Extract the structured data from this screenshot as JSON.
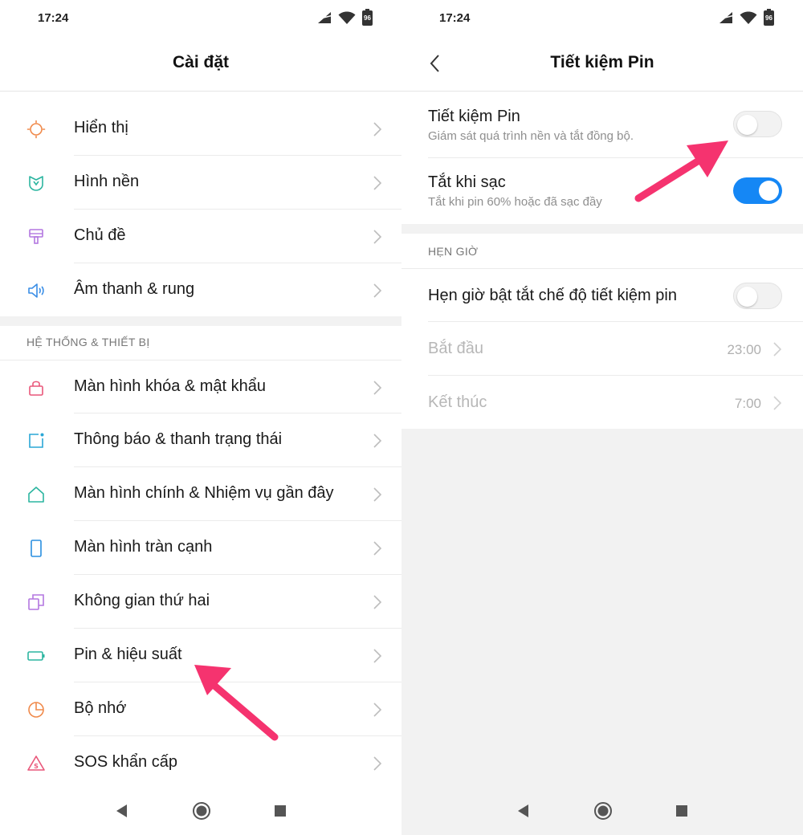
{
  "left": {
    "status": {
      "time": "17:24",
      "battery": "96"
    },
    "title": "Cài đặt",
    "items_top": [
      {
        "label": "Hiển thị",
        "icon": "display-icon"
      },
      {
        "label": "Hình nền",
        "icon": "wallpaper-icon"
      },
      {
        "label": "Chủ đề",
        "icon": "theme-brush-icon"
      },
      {
        "label": "Âm thanh & rung",
        "icon": "speaker-icon"
      }
    ],
    "section_label": "HỆ THỐNG & THIẾT BỊ",
    "items_system": [
      {
        "label": "Màn hình khóa & mật khẩu",
        "icon": "lock-icon"
      },
      {
        "label": "Thông báo & thanh trạng thái",
        "icon": "notification-icon"
      },
      {
        "label": "Màn hình chính & Nhiệm vụ gần đây",
        "icon": "home-icon"
      },
      {
        "label": "Màn hình tràn cạnh",
        "icon": "phone-icon"
      },
      {
        "label": "Không gian thứ hai",
        "icon": "second-space-icon"
      },
      {
        "label": "Pin & hiệu suất",
        "icon": "battery-icon"
      },
      {
        "label": "Bộ nhớ",
        "icon": "storage-pie-icon"
      },
      {
        "label": "SOS khẩn cấp",
        "icon": "sos-icon"
      }
    ]
  },
  "right": {
    "status": {
      "time": "17:24",
      "battery": "96"
    },
    "title": "Tiết kiệm Pin",
    "battery_saver": {
      "title": "Tiết kiệm Pin",
      "subtitle": "Giám sát quá trình nền và tắt đồng bộ.",
      "enabled": false
    },
    "off_when_charging": {
      "title": "Tắt khi sạc",
      "subtitle": "Tắt khi pin 60% hoặc đã sạc đầy",
      "enabled": true
    },
    "section_label": "HẸN GIỜ",
    "schedule": {
      "title": "Hẹn giờ bật tắt chế độ tiết kiệm pin",
      "enabled": false
    },
    "start": {
      "title": "Bắt đầu",
      "value": "23:00"
    },
    "end": {
      "title": "Kết thúc",
      "value": "7:00"
    }
  },
  "colors": {
    "accent_blue": "#1587f5",
    "arrow_pink": "#f5336f"
  }
}
